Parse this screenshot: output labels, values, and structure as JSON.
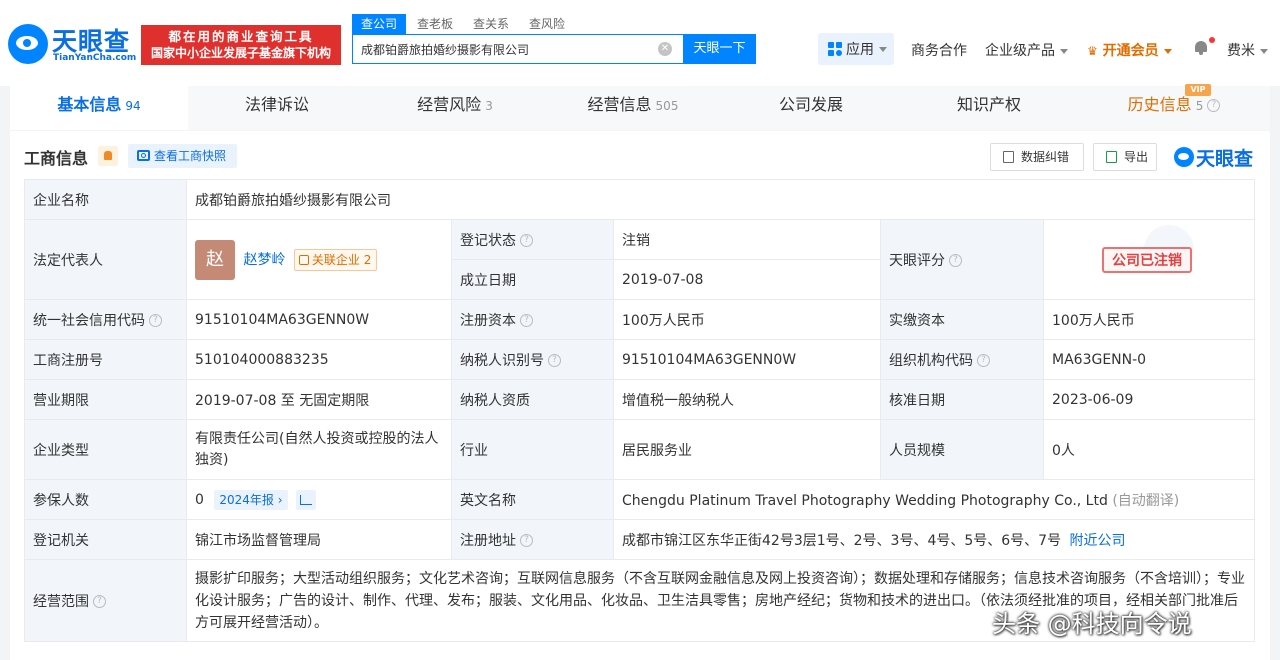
{
  "header": {
    "logo_name": "天眼查",
    "logo_domain": "TianYanCha.com",
    "banner_line1": "都在用的商业查询工具",
    "banner_line2": "国家中小企业发展子基金旗下机构",
    "search_tabs": [
      "查公司",
      "查老板",
      "查关系",
      "查风险"
    ],
    "search_value": "成都铂爵旅拍婚纱摄影有限公司",
    "search_button": "天眼一下",
    "apps_label": "应用",
    "business_label": "商务合作",
    "enterprise_label": "企业级产品",
    "vip_label": "开通会员",
    "user_label": "费米"
  },
  "tabs": [
    {
      "label": "基本信息",
      "count": "94"
    },
    {
      "label": "法律诉讼",
      "count": ""
    },
    {
      "label": "经营风险",
      "count": "3"
    },
    {
      "label": "经营信息",
      "count": "505"
    },
    {
      "label": "公司发展",
      "count": ""
    },
    {
      "label": "知识产权",
      "count": ""
    },
    {
      "label": "历史信息",
      "count": "5"
    }
  ],
  "vip_badge": "VIP",
  "section": {
    "title": "工商信息",
    "snapshot_label": "查看工商快照",
    "correction_label": "数据纠错",
    "export_label": "导出",
    "brand": "天眼查"
  },
  "info": {
    "company_name_label": "企业名称",
    "company_name": "成都铂爵旅拍婚纱摄影有限公司",
    "legal_rep_label": "法定代表人",
    "avatar_char": "赵",
    "legal_rep": "赵梦岭",
    "related_label": "关联企业",
    "related_count": "2",
    "reg_status_label": "登记状态",
    "reg_status": "注销",
    "found_date_label": "成立日期",
    "found_date": "2019-07-08",
    "rating_label": "天眼评分",
    "stamp_text": "公司已注销",
    "credit_code_label": "统一社会信用代码",
    "credit_code": "91510104MA63GENN0W",
    "reg_capital_label": "注册资本",
    "reg_capital": "100万人民币",
    "paid_capital_label": "实缴资本",
    "paid_capital": "100万人民币",
    "reg_no_label": "工商注册号",
    "reg_no": "510104000883235",
    "taxpayer_id_label": "纳税人识别号",
    "taxpayer_id": "91510104MA63GENN0W",
    "org_code_label": "组织机构代码",
    "org_code": "MA63GENN-0",
    "term_label": "营业期限",
    "term": "2019-07-08 至 无固定期限",
    "taxpayer_qual_label": "纳税人资质",
    "taxpayer_qual": "增值税一般纳税人",
    "approve_date_label": "核准日期",
    "approve_date": "2023-06-09",
    "type_label": "企业类型",
    "type": "有限责任公司(自然人投资或控股的法人独资)",
    "industry_label": "行业",
    "industry": "居民服务业",
    "staff_label": "人员规模",
    "staff": "0人",
    "insured_label": "参保人数",
    "insured": "0",
    "year_report": "2024年报",
    "english_label": "英文名称",
    "english_name": "Chengdu Platinum Travel Photography Wedding Photography Co., Ltd",
    "auto_translate": "(自动翻译)",
    "authority_label": "登记机关",
    "authority": "锦江市场监督管理局",
    "address_label": "注册地址",
    "address": "成都市锦江区东华正街42号3层1号、2号、3号、4号、5号、6号、7号",
    "nearby_label": "附近公司",
    "scope_label": "经营范围",
    "scope": "摄影扩印服务；大型活动组织服务；文化艺术咨询；互联网信息服务（不含互联网金融信息及网上投资咨询）；数据处理和存储服务；信息技术咨询服务（不含培训）；专业化设计服务；广告的设计、制作、代理、发布；服装、文化用品、化妆品、卫生洁具零售；房地产经纪；货物和技术的进出口。（依法须经批准的项目，经相关部门批准后方可展开经营活动）。"
  },
  "watermark": "头条 @科技向令说"
}
